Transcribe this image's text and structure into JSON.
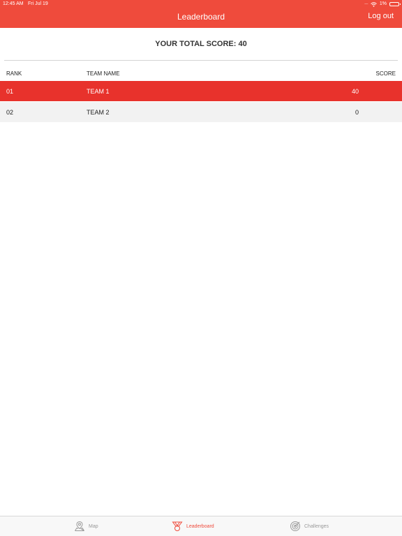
{
  "status_bar": {
    "time": "12:45 AM",
    "date": "Fri Jul 19",
    "battery": "1%"
  },
  "header": {
    "title": "Leaderboard",
    "logout_label": "Log out",
    "color": "#ef4b3c"
  },
  "summary": {
    "total_score_text": "YOUR TOTAL SCORE: 40"
  },
  "table": {
    "columns": [
      "RANK",
      "TEAM NAME",
      "SCORE"
    ],
    "rows": [
      {
        "rank": "01",
        "team": "TEAM 1",
        "score": "40",
        "highlighted": true
      },
      {
        "rank": "02",
        "team": "TEAM 2",
        "score": "0",
        "highlighted": false
      }
    ],
    "highlight_color": "#e8322c"
  },
  "tabbar": {
    "tabs": [
      {
        "label": "Map",
        "icon": "map-pin-icon",
        "active": false
      },
      {
        "label": "Leaderboard",
        "icon": "medal-icon",
        "active": true
      },
      {
        "label": "Challenges",
        "icon": "target-icon",
        "active": false
      }
    ]
  }
}
